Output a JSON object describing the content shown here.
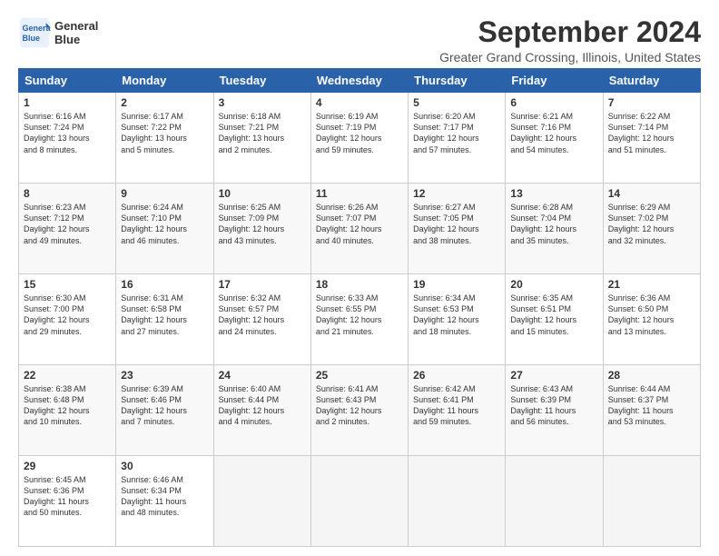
{
  "header": {
    "logo_line1": "General",
    "logo_line2": "Blue",
    "month": "September 2024",
    "location": "Greater Grand Crossing, Illinois, United States"
  },
  "days_of_week": [
    "Sunday",
    "Monday",
    "Tuesday",
    "Wednesday",
    "Thursday",
    "Friday",
    "Saturday"
  ],
  "weeks": [
    [
      {
        "day": "1",
        "lines": [
          "Sunrise: 6:16 AM",
          "Sunset: 7:24 PM",
          "Daylight: 13 hours",
          "and 8 minutes."
        ]
      },
      {
        "day": "2",
        "lines": [
          "Sunrise: 6:17 AM",
          "Sunset: 7:22 PM",
          "Daylight: 13 hours",
          "and 5 minutes."
        ]
      },
      {
        "day": "3",
        "lines": [
          "Sunrise: 6:18 AM",
          "Sunset: 7:21 PM",
          "Daylight: 13 hours",
          "and 2 minutes."
        ]
      },
      {
        "day": "4",
        "lines": [
          "Sunrise: 6:19 AM",
          "Sunset: 7:19 PM",
          "Daylight: 12 hours",
          "and 59 minutes."
        ]
      },
      {
        "day": "5",
        "lines": [
          "Sunrise: 6:20 AM",
          "Sunset: 7:17 PM",
          "Daylight: 12 hours",
          "and 57 minutes."
        ]
      },
      {
        "day": "6",
        "lines": [
          "Sunrise: 6:21 AM",
          "Sunset: 7:16 PM",
          "Daylight: 12 hours",
          "and 54 minutes."
        ]
      },
      {
        "day": "7",
        "lines": [
          "Sunrise: 6:22 AM",
          "Sunset: 7:14 PM",
          "Daylight: 12 hours",
          "and 51 minutes."
        ]
      }
    ],
    [
      {
        "day": "8",
        "lines": [
          "Sunrise: 6:23 AM",
          "Sunset: 7:12 PM",
          "Daylight: 12 hours",
          "and 49 minutes."
        ]
      },
      {
        "day": "9",
        "lines": [
          "Sunrise: 6:24 AM",
          "Sunset: 7:10 PM",
          "Daylight: 12 hours",
          "and 46 minutes."
        ]
      },
      {
        "day": "10",
        "lines": [
          "Sunrise: 6:25 AM",
          "Sunset: 7:09 PM",
          "Daylight: 12 hours",
          "and 43 minutes."
        ]
      },
      {
        "day": "11",
        "lines": [
          "Sunrise: 6:26 AM",
          "Sunset: 7:07 PM",
          "Daylight: 12 hours",
          "and 40 minutes."
        ]
      },
      {
        "day": "12",
        "lines": [
          "Sunrise: 6:27 AM",
          "Sunset: 7:05 PM",
          "Daylight: 12 hours",
          "and 38 minutes."
        ]
      },
      {
        "day": "13",
        "lines": [
          "Sunrise: 6:28 AM",
          "Sunset: 7:04 PM",
          "Daylight: 12 hours",
          "and 35 minutes."
        ]
      },
      {
        "day": "14",
        "lines": [
          "Sunrise: 6:29 AM",
          "Sunset: 7:02 PM",
          "Daylight: 12 hours",
          "and 32 minutes."
        ]
      }
    ],
    [
      {
        "day": "15",
        "lines": [
          "Sunrise: 6:30 AM",
          "Sunset: 7:00 PM",
          "Daylight: 12 hours",
          "and 29 minutes."
        ]
      },
      {
        "day": "16",
        "lines": [
          "Sunrise: 6:31 AM",
          "Sunset: 6:58 PM",
          "Daylight: 12 hours",
          "and 27 minutes."
        ]
      },
      {
        "day": "17",
        "lines": [
          "Sunrise: 6:32 AM",
          "Sunset: 6:57 PM",
          "Daylight: 12 hours",
          "and 24 minutes."
        ]
      },
      {
        "day": "18",
        "lines": [
          "Sunrise: 6:33 AM",
          "Sunset: 6:55 PM",
          "Daylight: 12 hours",
          "and 21 minutes."
        ]
      },
      {
        "day": "19",
        "lines": [
          "Sunrise: 6:34 AM",
          "Sunset: 6:53 PM",
          "Daylight: 12 hours",
          "and 18 minutes."
        ]
      },
      {
        "day": "20",
        "lines": [
          "Sunrise: 6:35 AM",
          "Sunset: 6:51 PM",
          "Daylight: 12 hours",
          "and 15 minutes."
        ]
      },
      {
        "day": "21",
        "lines": [
          "Sunrise: 6:36 AM",
          "Sunset: 6:50 PM",
          "Daylight: 12 hours",
          "and 13 minutes."
        ]
      }
    ],
    [
      {
        "day": "22",
        "lines": [
          "Sunrise: 6:38 AM",
          "Sunset: 6:48 PM",
          "Daylight: 12 hours",
          "and 10 minutes."
        ]
      },
      {
        "day": "23",
        "lines": [
          "Sunrise: 6:39 AM",
          "Sunset: 6:46 PM",
          "Daylight: 12 hours",
          "and 7 minutes."
        ]
      },
      {
        "day": "24",
        "lines": [
          "Sunrise: 6:40 AM",
          "Sunset: 6:44 PM",
          "Daylight: 12 hours",
          "and 4 minutes."
        ]
      },
      {
        "day": "25",
        "lines": [
          "Sunrise: 6:41 AM",
          "Sunset: 6:43 PM",
          "Daylight: 12 hours",
          "and 2 minutes."
        ]
      },
      {
        "day": "26",
        "lines": [
          "Sunrise: 6:42 AM",
          "Sunset: 6:41 PM",
          "Daylight: 11 hours",
          "and 59 minutes."
        ]
      },
      {
        "day": "27",
        "lines": [
          "Sunrise: 6:43 AM",
          "Sunset: 6:39 PM",
          "Daylight: 11 hours",
          "and 56 minutes."
        ]
      },
      {
        "day": "28",
        "lines": [
          "Sunrise: 6:44 AM",
          "Sunset: 6:37 PM",
          "Daylight: 11 hours",
          "and 53 minutes."
        ]
      }
    ],
    [
      {
        "day": "29",
        "lines": [
          "Sunrise: 6:45 AM",
          "Sunset: 6:36 PM",
          "Daylight: 11 hours",
          "and 50 minutes."
        ]
      },
      {
        "day": "30",
        "lines": [
          "Sunrise: 6:46 AM",
          "Sunset: 6:34 PM",
          "Daylight: 11 hours",
          "and 48 minutes."
        ]
      },
      {
        "day": "",
        "lines": []
      },
      {
        "day": "",
        "lines": []
      },
      {
        "day": "",
        "lines": []
      },
      {
        "day": "",
        "lines": []
      },
      {
        "day": "",
        "lines": []
      }
    ]
  ]
}
